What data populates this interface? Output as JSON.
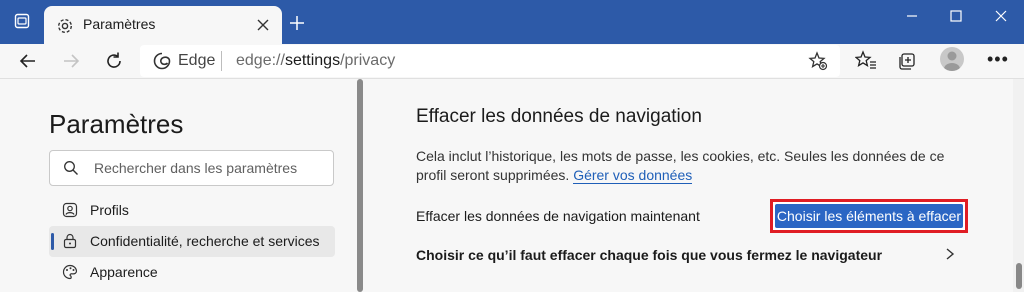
{
  "tab": {
    "title": "Paramètres"
  },
  "address": {
    "brand": "Edge",
    "url_prefix": "edge://",
    "url_host": "settings",
    "url_path": "/privacy"
  },
  "sidebar": {
    "title": "Paramètres",
    "search_placeholder": "Rechercher dans les paramètres",
    "items": [
      {
        "label": "Profils",
        "icon": "profile-icon",
        "active": false
      },
      {
        "label": "Confidentialité, recherche et services",
        "icon": "lock-icon",
        "active": true
      },
      {
        "label": "Apparence",
        "icon": "palette-icon",
        "active": false
      }
    ]
  },
  "main": {
    "section_title": "Effacer les données de navigation",
    "description": "Cela inclut l’historique, les mots de passe, les cookies, etc. Seules les données de ce profil seront supprimées.",
    "manage_link": "Gérer vos données",
    "clear_now_label": "Effacer les données de navigation maintenant",
    "choose_button": "Choisir les éléments à effacer",
    "on_close_label": "Choisir ce qu’il faut effacer chaque fois que vous fermez le navigateur"
  },
  "colors": {
    "titlebar": "#2d5aa8",
    "accent": "#2b66c4",
    "highlight_border": "#e01d24"
  }
}
